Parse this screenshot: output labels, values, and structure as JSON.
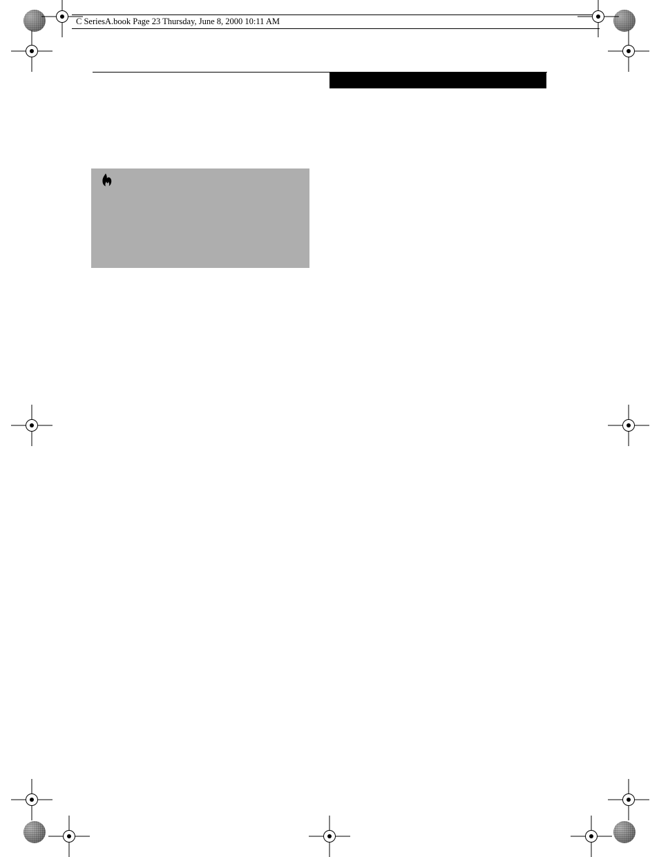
{
  "header": {
    "text": "C SeriesA.book  Page 23  Thursday, June 8, 2000  10:11 AM"
  },
  "icons": {
    "flame": "flame-icon"
  }
}
